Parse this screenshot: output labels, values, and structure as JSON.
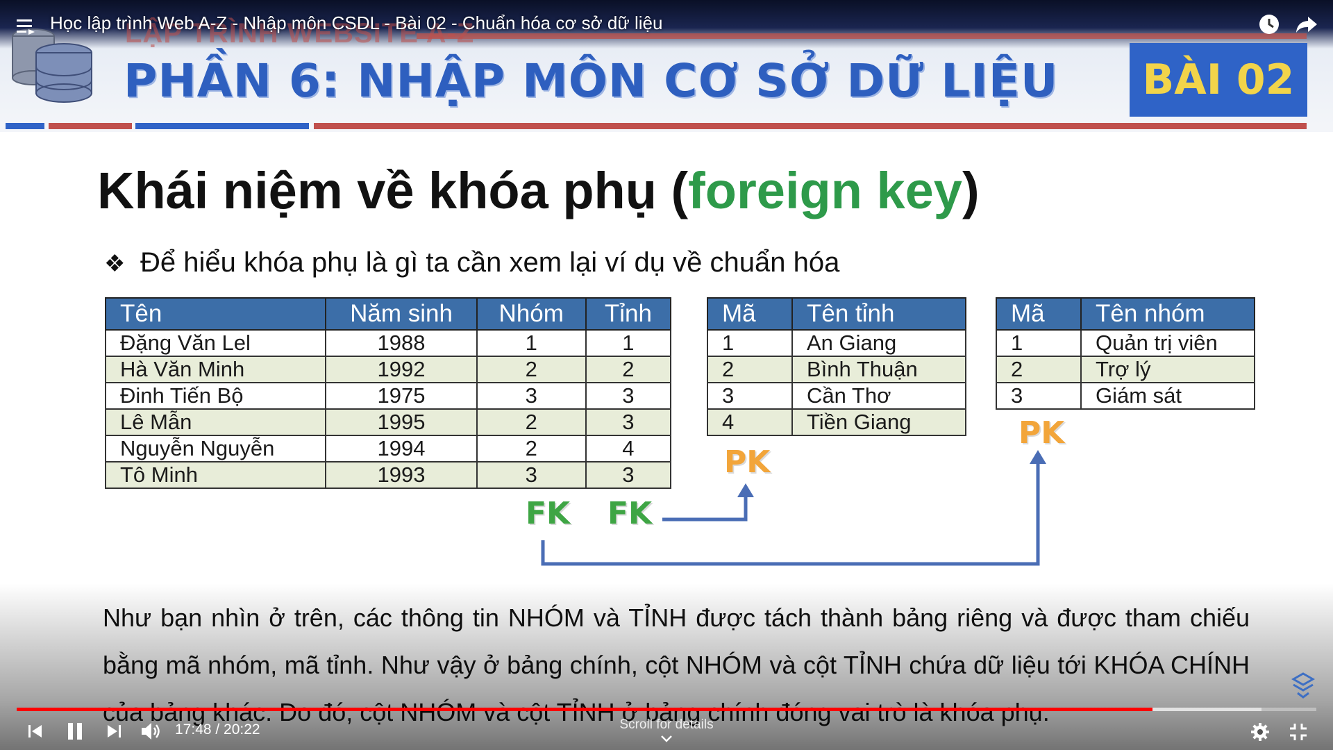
{
  "player": {
    "video_title": "Học lập trình Web A-Z - Nhập môn CSDL - Bài 02 - Chuẩn hóa cơ sở dữ liệu",
    "time_current": "17:48",
    "time_total": "20:22",
    "time_display": "17:48 / 20:22",
    "scroll_hint": "Scroll for details",
    "progress_played_fraction": 0.874,
    "progress_loaded_fraction": 0.958,
    "accent_color": "#ff0000",
    "icons": [
      "playlist-icon",
      "watch-later-icon",
      "share-icon",
      "previous-icon",
      "pause-icon",
      "next-icon",
      "volume-icon",
      "settings-icon",
      "exit-fullscreen-icon",
      "channel-watermark-icon",
      "chevron-down-icon"
    ]
  },
  "slide": {
    "brand_faded": "LẬP TRÌNH WEBSITE A-Z",
    "part_title": "PHẦN 6: NHẬP MÔN CƠ SỞ DỮ LIỆU",
    "lesson_badge": "BÀI 02",
    "title_prefix": "Khái niệm về khóa phụ (",
    "title_highlight": "foreign key",
    "title_suffix": ")",
    "bullet": "Để hiểu khóa phụ là gì ta cần xem lại ví dụ về chuẩn hóa",
    "main_table": {
      "headers": [
        "Tên",
        "Năm sinh",
        "Nhóm",
        "Tỉnh"
      ],
      "rows": [
        [
          "Đặng Văn Lel",
          "1988",
          "1",
          "1"
        ],
        [
          "Hà Văn Minh",
          "1992",
          "2",
          "2"
        ],
        [
          "Đinh Tiến Bộ",
          "1975",
          "3",
          "3"
        ],
        [
          "Lê Mẫn",
          "1995",
          "2",
          "3"
        ],
        [
          "Nguyễn Nguyễn",
          "1994",
          "2",
          "4"
        ],
        [
          "Tô Minh",
          "1993",
          "3",
          "3"
        ]
      ]
    },
    "province_table": {
      "headers": [
        "Mã",
        "Tên tỉnh"
      ],
      "rows": [
        [
          "1",
          "An Giang"
        ],
        [
          "2",
          "Bình Thuận"
        ],
        [
          "3",
          "Cần Thơ"
        ],
        [
          "4",
          "Tiền Giang"
        ]
      ]
    },
    "group_table": {
      "headers": [
        "Mã",
        "Tên nhóm"
      ],
      "rows": [
        [
          "1",
          "Quản trị viên"
        ],
        [
          "2",
          "Trợ lý"
        ],
        [
          "3",
          "Giám sát"
        ]
      ]
    },
    "fk_label": "FK",
    "pk_label": "PK",
    "paragraph": "Như bạn nhìn ở trên, các thông tin NHÓM và TỈNH được tách thành bảng riêng và được tham chiếu bằng mã nhóm, mã tỉnh. Như vậy ở bảng chính, cột NHÓM và cột TỈNH chứa dữ liệu tới KHÓA CHÍNH của bảng khác. Do đó, cột NHÓM và cột TỈNH ở bảng chính đóng vai trò là khóa phụ.",
    "colors": {
      "header_blue": "#3c6ea8",
      "row_tint": "#e8edd9",
      "fk_green": "#3ea544",
      "pk_orange": "#f2a53a",
      "arrow_blue": "#4a6db5",
      "title_green": "#2e9a4a"
    }
  }
}
